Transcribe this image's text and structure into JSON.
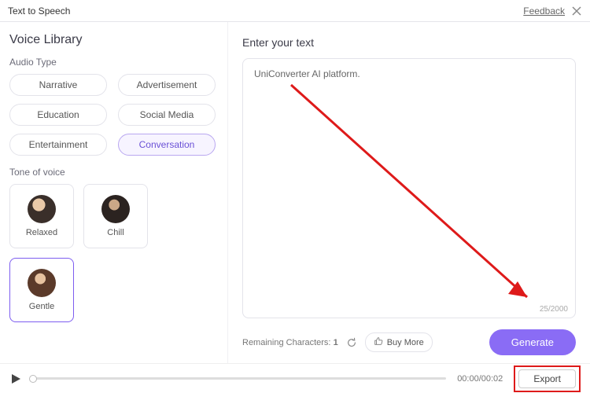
{
  "topbar": {
    "title": "Text to Speech",
    "feedback_label": "Feedback"
  },
  "sidebar": {
    "title": "Voice Library",
    "audio_type_label": "Audio Type",
    "audio_types": [
      {
        "label": "Narrative"
      },
      {
        "label": "Advertisement"
      },
      {
        "label": "Education"
      },
      {
        "label": "Social Media"
      },
      {
        "label": "Entertainment"
      },
      {
        "label": "Conversation",
        "selected": true
      }
    ],
    "tone_label": "Tone of voice",
    "voices": [
      {
        "label": "Relaxed",
        "avatar_bg": "radial-gradient(circle at 40% 35%, #e9c9a8 0 25%, #3a2f2a 26% 100%)"
      },
      {
        "label": "Chill",
        "avatar_bg": "radial-gradient(circle at 45% 35%, #caa787 0 22%, #2b2320 23% 100%)"
      },
      {
        "label": "Gentle",
        "avatar_bg": "radial-gradient(circle at 45% 35%, #e7c2a0 0 22%, #5b3a2a 23% 100%)",
        "selected": true
      }
    ]
  },
  "main": {
    "title": "Enter your text",
    "text_value": "UniConverter AI platform.",
    "char_count": "25/2000",
    "remaining_label": "Remaining Characters:",
    "remaining_value": "1",
    "buy_more_label": "Buy More",
    "generate_label": "Generate"
  },
  "player": {
    "time": "00:00/00:02",
    "export_label": "Export"
  }
}
